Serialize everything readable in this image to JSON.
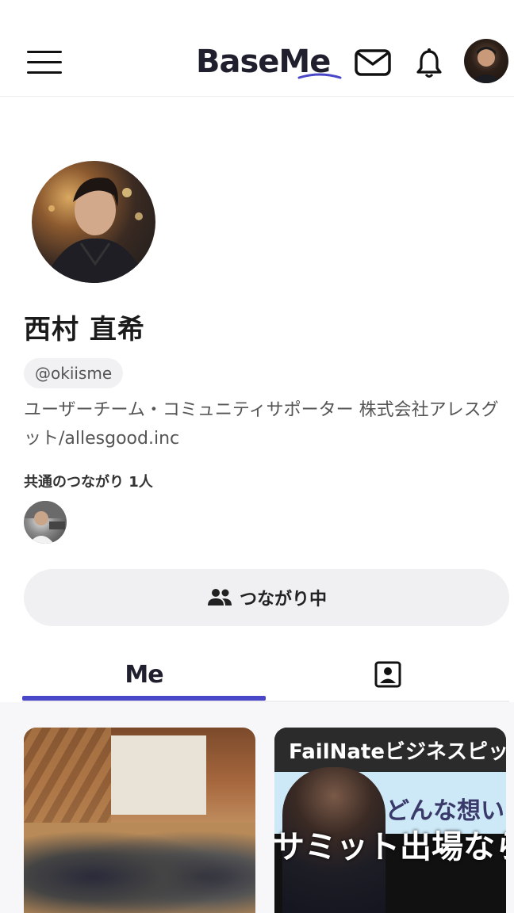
{
  "header": {
    "logo_text": "BaseMe",
    "menu_icon": "hamburger-menu-icon",
    "mail_icon": "mail-icon",
    "bell_icon": "bell-icon"
  },
  "profile": {
    "name": "西村 直希",
    "handle": "@okiisme",
    "bio": "ユーザーチーム・コミュニティサポーター 株式会社アレスグット/allesgood.inc",
    "mutual_label": "共通のつながり 1人"
  },
  "actions": {
    "connect_label": "つながり中",
    "connect_icon": "people-icon"
  },
  "tabs": [
    {
      "label": "Me",
      "active": true
    },
    {
      "label": "",
      "icon": "profile-card-icon",
      "active": false
    }
  ],
  "cards": [
    {
      "type": "photo"
    },
    {
      "type": "video",
      "title_text": "FailNateビジネスピッチ",
      "subtitle_text": "どんな想い",
      "headline_text": "サミット出場なら"
    }
  ],
  "colors": {
    "accent": "#4a46c8",
    "button_bg": "#f0f0f2",
    "badge_bg": "#f1f1f3"
  }
}
